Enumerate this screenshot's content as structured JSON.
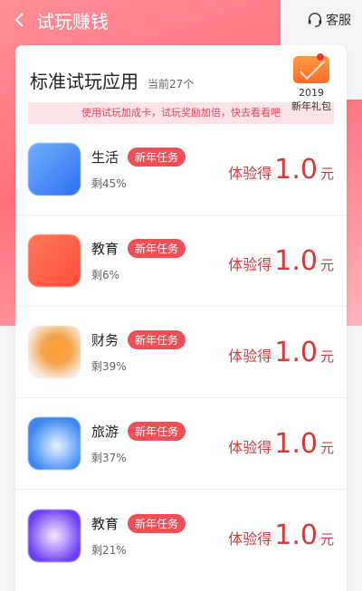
{
  "header": {
    "title": "试玩赚钱",
    "service_label": "客服"
  },
  "card": {
    "title": "标准试玩应用",
    "count": "当前27个",
    "tip": "使用试玩加成卡，试玩奖励加倍，快去看看吧"
  },
  "gift": {
    "year": "2019",
    "label": "新年礼包"
  },
  "items": [
    {
      "name": "生活",
      "badge": "新年任务",
      "remain": "剩45%",
      "reward_prefix": "体验得",
      "amount": "1.0",
      "unit": "元",
      "icon": "app-icon-blue"
    },
    {
      "name": "教育",
      "badge": "新年任务",
      "remain": "剩6%",
      "reward_prefix": "体验得",
      "amount": "1.0",
      "unit": "元",
      "icon": "app-icon-orange-x"
    },
    {
      "name": "财务",
      "badge": "新年任务",
      "remain": "剩39%",
      "reward_prefix": "体验得",
      "amount": "1.0",
      "unit": "元",
      "icon": "app-icon-orange-fruit"
    },
    {
      "name": "旅游",
      "badge": "新年任务",
      "remain": "剩37%",
      "reward_prefix": "体验得",
      "amount": "1.0",
      "unit": "元",
      "icon": "app-icon-blue-travel"
    },
    {
      "name": "教育",
      "badge": "新年任务",
      "remain": "剩21%",
      "reward_prefix": "体验得",
      "amount": "1.0",
      "unit": "元",
      "icon": "app-icon-purple"
    }
  ],
  "colors": {
    "accent": "#ef4f56",
    "reward": "#d43a3a",
    "header_gradient_start": "#ff8f98",
    "tip_bg": "#fde3e6"
  }
}
